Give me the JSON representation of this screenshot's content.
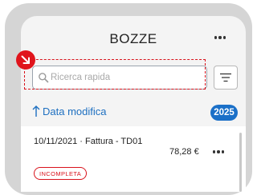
{
  "header": {
    "title": "BOZZE",
    "more_icon": "more-horizontal-icon"
  },
  "search": {
    "placeholder": "Ricerca rapida",
    "value": ""
  },
  "filter": {
    "icon": "filter-lines-icon"
  },
  "sort": {
    "label": "Data modifica",
    "direction_icon": "arrow-up-icon"
  },
  "year_badge": "2025",
  "list": [
    {
      "title": "10/11/2021 · Fattura - TD01",
      "amount": "78,28 €",
      "status": "INCOMPLETA"
    }
  ],
  "colors": {
    "accent": "#1b70c8",
    "highlight": "#d9121b",
    "status_incomplete": "#d9121b"
  }
}
